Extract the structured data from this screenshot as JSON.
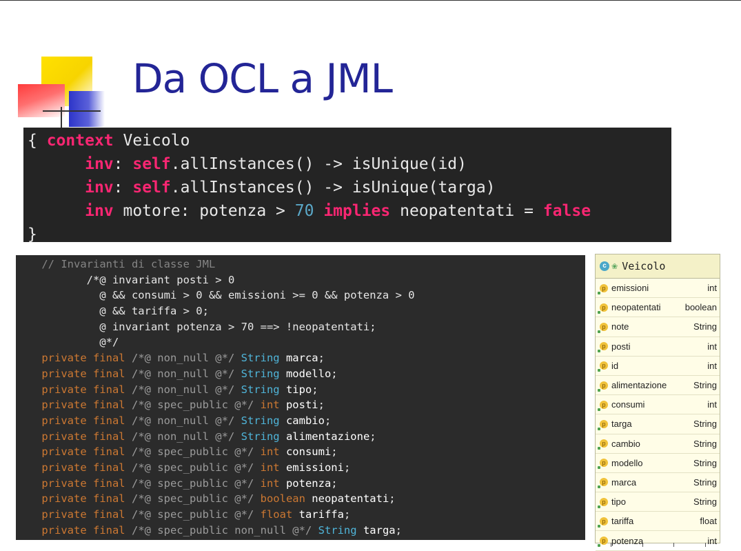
{
  "slide": {
    "title": "Da OCL a JML"
  },
  "ocl_code": {
    "line1": {
      "brace": "{ ",
      "context_kw": "context",
      "rest": " Veicolo"
    },
    "line2": {
      "indent": "      ",
      "inv_kw": "inv",
      "colon": ": ",
      "self_kw": "self",
      "rest": ".allInstances() -> isUnique(id)"
    },
    "line3": {
      "indent": "      ",
      "inv_kw": "inv",
      "colon": ": ",
      "self_kw": "self",
      "rest": ".allInstances() -> isUnique(targa)"
    },
    "line4": {
      "indent": "      ",
      "inv_kw": "inv",
      "mid": " motore: potenza > ",
      "num": "70",
      "sp1": " ",
      "implies_kw": "implies",
      "mid2": " neopatentati = ",
      "false_kw": "false"
    },
    "line5": {
      "brace": "}"
    }
  },
  "jml_code": {
    "comment": "    // Invarianti di classe JML",
    "inv_lines": [
      "           /*@ invariant posti > 0",
      "             @ && consumi > 0 && emissioni >= 0 && potenza > 0",
      "             @ && tariffa > 0;",
      "             @ invariant potenza > 70 ==> !neopatentati;",
      "             @*/"
    ],
    "fields": [
      {
        "mod": "    private final ",
        "ann": "/*@ non_null @*/ ",
        "type": "String",
        "prim": "",
        "name": "marca",
        "semi": ";"
      },
      {
        "mod": "    private final ",
        "ann": "/*@ non_null @*/ ",
        "type": "String",
        "prim": "",
        "name": "modello",
        "semi": ";"
      },
      {
        "mod": "    private final ",
        "ann": "/*@ non_null @*/ ",
        "type": "String",
        "prim": "",
        "name": "tipo",
        "semi": ";"
      },
      {
        "mod": "    private final ",
        "ann": "/*@ spec_public @*/ ",
        "type": "",
        "prim": "int",
        "name": "posti",
        "semi": ";"
      },
      {
        "mod": "    private final ",
        "ann": "/*@ non_null @*/ ",
        "type": "String",
        "prim": "",
        "name": "cambio",
        "semi": ";"
      },
      {
        "mod": "    private final ",
        "ann": "/*@ non_null @*/ ",
        "type": "String",
        "prim": "",
        "name": "alimentazione",
        "semi": ";"
      },
      {
        "mod": "    private final ",
        "ann": "/*@ spec_public @*/ ",
        "type": "",
        "prim": "int",
        "name": "consumi",
        "semi": ";"
      },
      {
        "mod": "    private final ",
        "ann": "/*@ spec_public @*/ ",
        "type": "",
        "prim": "int",
        "name": "emissioni",
        "semi": ";"
      },
      {
        "mod": "    private final ",
        "ann": "/*@ spec_public @*/ ",
        "type": "",
        "prim": "int",
        "name": "potenza",
        "semi": ";"
      },
      {
        "mod": "    private final ",
        "ann": "/*@ spec_public @*/ ",
        "type": "",
        "prim": "boolean",
        "name": "neopatentati",
        "semi": ";"
      },
      {
        "mod": "    private final ",
        "ann": "/*@ spec_public @*/ ",
        "type": "",
        "prim": "float",
        "name": "tariffa",
        "semi": ";"
      },
      {
        "mod": "    private final ",
        "ann": "/*@ spec_public non_null @*/ ",
        "type": "String",
        "prim": "",
        "name": "targa",
        "semi": ";"
      }
    ]
  },
  "uml": {
    "class_badge": "c",
    "class_name": "Veicolo",
    "property_badge": "p",
    "rows": [
      {
        "name": "emissioni",
        "type": "int"
      },
      {
        "name": "neopatentati",
        "type": "boolean"
      },
      {
        "name": "note",
        "type": "String"
      },
      {
        "name": "posti",
        "type": "int"
      },
      {
        "name": "id",
        "type": "int"
      },
      {
        "name": "alimentazione",
        "type": "String"
      },
      {
        "name": "consumi",
        "type": "int"
      },
      {
        "name": "targa",
        "type": "String"
      },
      {
        "name": "cambio",
        "type": "String"
      },
      {
        "name": "modello",
        "type": "String"
      },
      {
        "name": "marca",
        "type": "String"
      },
      {
        "name": "tipo",
        "type": "String"
      },
      {
        "name": "tariffa",
        "type": "float"
      },
      {
        "name": "potenza",
        "type": "int"
      }
    ]
  }
}
